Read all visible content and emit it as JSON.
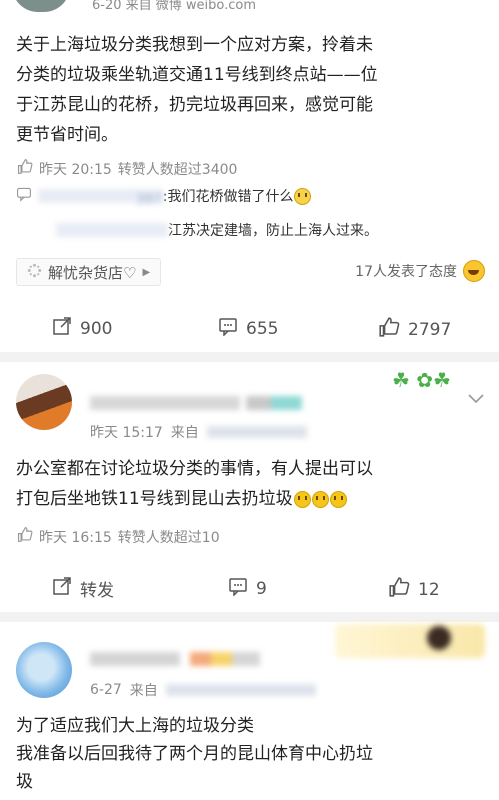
{
  "post1": {
    "header_source": "6-20 来自 微博 weibo.com",
    "text_lines": [
      "关于上海垃圾分类我想到一个应对方案，拎着未",
      "分类的垃圾乘坐轨道交通11号线到终点站——位",
      "于江苏昆山的花桥，扔完垃圾再回来，感觉可能",
      "更节省时间。"
    ],
    "time": "昨天 20:15",
    "repost_note": "转赞人数超过3400",
    "reply1_user": "　　　　　　　397",
    "reply1_text": ":我们花桥做错了什么",
    "reply2_user": "　　　　　　　　",
    "reply2_text": "江苏决定建墙，防止上海人过来。",
    "chip_label": "解忧杂货店♡",
    "attitude_text": "17人发表了态度",
    "repost_count": "900",
    "comment_count": "655",
    "like_count": "2797"
  },
  "post2": {
    "username": "　　　　　",
    "time": "昨天 15:17",
    "source_prefix": "来自",
    "text_lines": [
      "办公室都在讨论垃圾分类的事情，有人提出可以",
      "打包后坐地铁11号线到昆山去扔垃圾"
    ],
    "meta_time": "昨天 16:15",
    "repost_note": "转赞人数超过10",
    "repost_label": "转发",
    "comment_count": "9",
    "like_count": "12"
  },
  "post3": {
    "username": "　　　　",
    "time": "6-27",
    "source_prefix": "来自",
    "text_lines": [
      "为了适应我们大上海的垃圾分类",
      "我准备以后回我待了两个月的昆山体育中心扔垃",
      "圾"
    ]
  },
  "colors": {
    "accent": "#eb7350",
    "muted": "#8a8a8a",
    "background": "#f2f2f2"
  }
}
